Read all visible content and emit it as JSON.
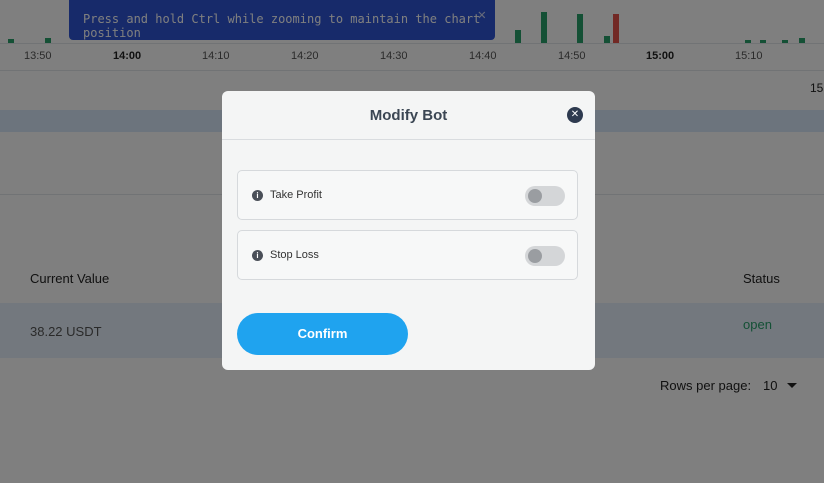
{
  "tooltip": {
    "text": "Press and hold Ctrl while zooming to maintain the chart position",
    "close_glyph": "✕"
  },
  "chart": {
    "time_ticks": [
      "13:50",
      "14:00",
      "14:10",
      "14:20",
      "14:30",
      "14:40",
      "14:50",
      "15:00",
      "15:10"
    ],
    "bold_ticks": [
      "14:00",
      "15:00"
    ],
    "up_color": "#28a06b",
    "down_color": "#e5534b"
  },
  "background_page": {
    "corner_label": "15",
    "table": {
      "headers": {
        "current_value": "Current Value",
        "status": "Status"
      },
      "row": {
        "current_value": "38.22 USDT",
        "status": "open"
      }
    },
    "pagination": {
      "rows_per_page_label": "Rows per page:",
      "rows_per_page_value": "10"
    }
  },
  "modal": {
    "title": "Modify Bot",
    "close_icon": "close-icon",
    "options": [
      {
        "label": "Take Profit",
        "enabled": false
      },
      {
        "label": "Stop Loss",
        "enabled": false
      }
    ],
    "info_glyph": "i",
    "confirm_label": "Confirm",
    "accent_color": "#1fa3ef"
  }
}
